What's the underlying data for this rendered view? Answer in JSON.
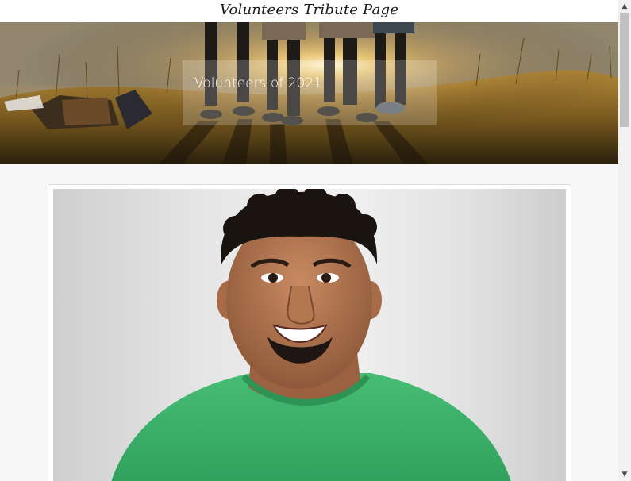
{
  "page": {
    "title": "Volunteers Tribute Page"
  },
  "hero": {
    "heading": "Volunteers of 2021"
  },
  "scrollbar": {
    "up_arrow": "▲",
    "down_arrow": "▼",
    "scroll_position": 0
  },
  "colors": {
    "page_background": "#f7f7f7",
    "card_border": "#dcdcdc",
    "shirt_green": "#3db36b"
  },
  "icons": {
    "scroll_up": "scroll-up-arrow-icon",
    "scroll_down": "scroll-down-arrow-icon"
  }
}
